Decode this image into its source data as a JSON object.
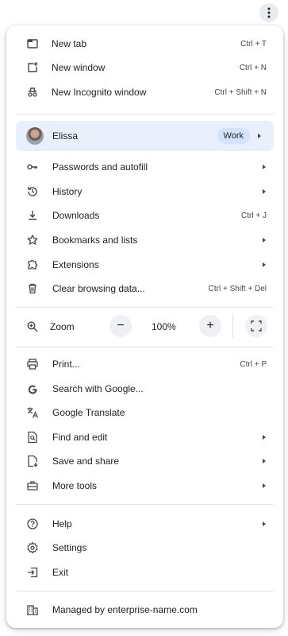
{
  "menu": {
    "new_tab": {
      "label": "New tab",
      "shortcut": "Ctrl + T"
    },
    "new_window": {
      "label": "New window",
      "shortcut": "Ctrl + N"
    },
    "incognito": {
      "label": "New Incognito window",
      "shortcut": "Ctrl + Shift + N"
    },
    "profile": {
      "name": "Elissa",
      "badge": "Work"
    },
    "passwords": {
      "label": "Passwords and autofill"
    },
    "history": {
      "label": "History"
    },
    "downloads": {
      "label": "Downloads",
      "shortcut": "Ctrl + J"
    },
    "bookmarks": {
      "label": "Bookmarks and lists"
    },
    "extensions": {
      "label": "Extensions"
    },
    "clear": {
      "label": "Clear browsing data...",
      "shortcut": "Ctrl + Shift + Del"
    },
    "zoom": {
      "label": "Zoom",
      "value": "100%",
      "minus": "−",
      "plus": "+"
    },
    "print": {
      "label": "Print...",
      "shortcut": "Ctrl + P"
    },
    "search_google": {
      "label": "Search with Google..."
    },
    "translate": {
      "label": "Google Translate"
    },
    "find_edit": {
      "label": "Find and edit"
    },
    "save_share": {
      "label": "Save and share"
    },
    "more_tools": {
      "label": "More tools"
    },
    "help": {
      "label": "Help"
    },
    "settings": {
      "label": "Settings"
    },
    "exit": {
      "label": "Exit"
    },
    "managed": {
      "label": "Managed by enterprise-name.com"
    }
  },
  "colors": {
    "accent_bg": "#e9effb",
    "badge_bg": "#d3e3fd",
    "icon": "#444746"
  }
}
